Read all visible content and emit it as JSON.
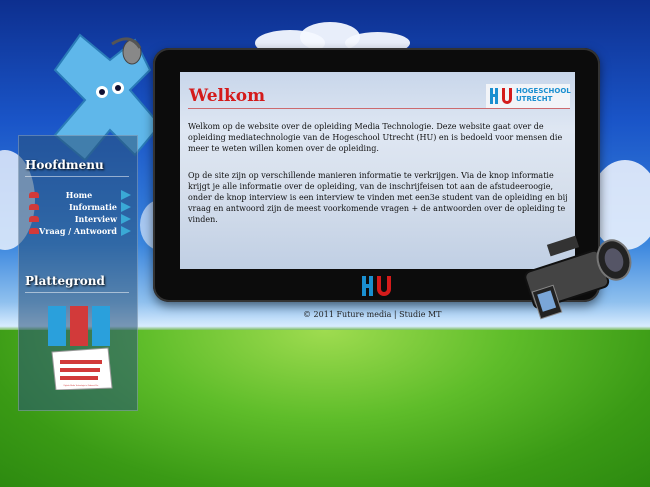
{
  "sidebar": {
    "menu_title": "Hoofdmenu",
    "menu_items": [
      {
        "label": "Home"
      },
      {
        "label": "Informatie"
      },
      {
        "label": "Interview"
      },
      {
        "label": "Vraag / Antwoord"
      }
    ],
    "sitemap_title": "Plattegrond",
    "sitemap_caption": "Digitale Media Technologie te Zuidwest Pire"
  },
  "main": {
    "title": "Welkom",
    "logo": {
      "line1": "HOGESCHOOL",
      "line2": "UTRECHT"
    },
    "paragraphs": [
      "Welkom op de website over de opleiding Media Technologie. Deze website gaat over de opleiding mediatechnologie van de Hogeschool Utrecht (HU) en is bedoeld voor mensen die meer te weten willen komen over de opleiding.",
      "Op de site zijn op verschillende manieren informatie te verkrijgen. Via de knop informatie krijgt je alle informatie over de opleiding, van de inschrijfeisen tot aan de afstudeeroogie, onder de knop interview is een interview te vinden met een3e student van de opleiding en bij vraag en antwoord zijn de meest voorkomende vragen + de antwoorden over de opleiding te vinden."
    ]
  },
  "footer": {
    "text": "© 2011 Future media | Studie MT"
  },
  "colors": {
    "accent_red": "#d41b1b",
    "hu_blue": "#1a8fd0"
  }
}
